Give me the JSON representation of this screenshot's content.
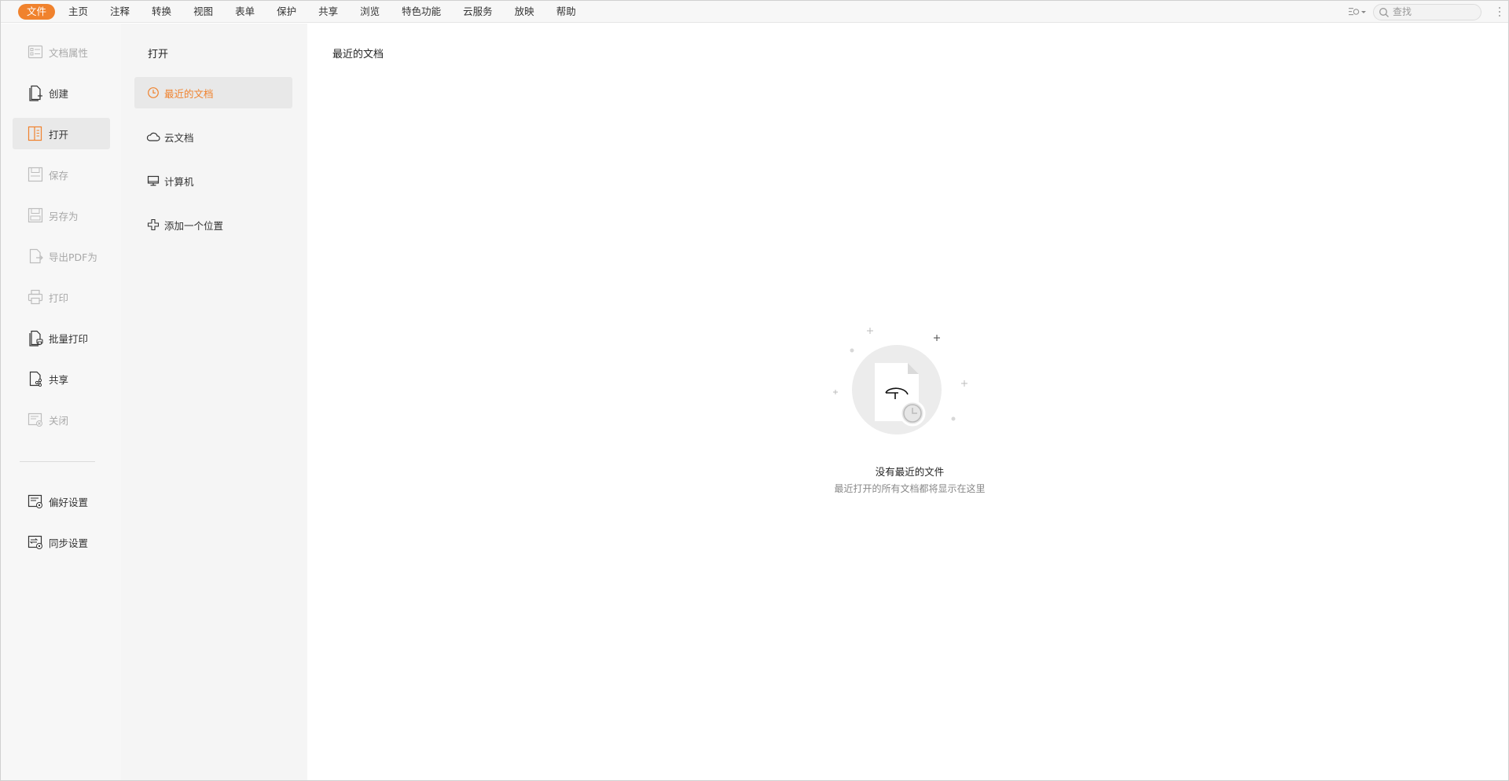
{
  "colors": {
    "accent": "#f0822d",
    "disabled_text": "#a8a8a8"
  },
  "menubar": {
    "items": [
      {
        "label": "文件",
        "active": true
      },
      {
        "label": "主页"
      },
      {
        "label": "注释"
      },
      {
        "label": "转换"
      },
      {
        "label": "视图"
      },
      {
        "label": "表单"
      },
      {
        "label": "保护"
      },
      {
        "label": "共享"
      },
      {
        "label": "浏览"
      },
      {
        "label": "特色功能"
      },
      {
        "label": "云服务"
      },
      {
        "label": "放映"
      },
      {
        "label": "帮助"
      }
    ],
    "search_placeholder": "查找"
  },
  "left_nav": {
    "items": [
      {
        "label": "文档属性",
        "icon": "document-properties-icon",
        "disabled": true
      },
      {
        "label": "创建",
        "icon": "create-icon"
      },
      {
        "label": "打开",
        "icon": "open-icon",
        "selected": true
      },
      {
        "label": "保存",
        "icon": "save-icon",
        "disabled": true
      },
      {
        "label": "另存为",
        "icon": "save-as-icon",
        "disabled": true
      },
      {
        "label": "导出PDF为",
        "icon": "export-pdf-icon",
        "disabled": true
      },
      {
        "label": "打印",
        "icon": "print-icon",
        "disabled": true
      },
      {
        "label": "批量打印",
        "icon": "batch-print-icon"
      },
      {
        "label": "共享",
        "icon": "share-icon"
      },
      {
        "label": "关闭",
        "icon": "close-document-icon",
        "disabled": true
      }
    ],
    "bottom_items": [
      {
        "label": "偏好设置",
        "icon": "preferences-icon"
      },
      {
        "label": "同步设置",
        "icon": "sync-settings-icon"
      }
    ]
  },
  "sub_panel": {
    "title": "打开",
    "items": [
      {
        "label": "最近的文档",
        "icon": "clock-icon",
        "selected": true
      },
      {
        "label": "云文档",
        "icon": "cloud-icon"
      },
      {
        "label": "计算机",
        "icon": "computer-icon"
      },
      {
        "label": "添加一个位置",
        "icon": "add-location-icon"
      }
    ]
  },
  "main": {
    "title": "最近的文档",
    "empty_title": "没有最近的文件",
    "empty_subtitle": "最近打开的所有文档都将显示在这里"
  }
}
